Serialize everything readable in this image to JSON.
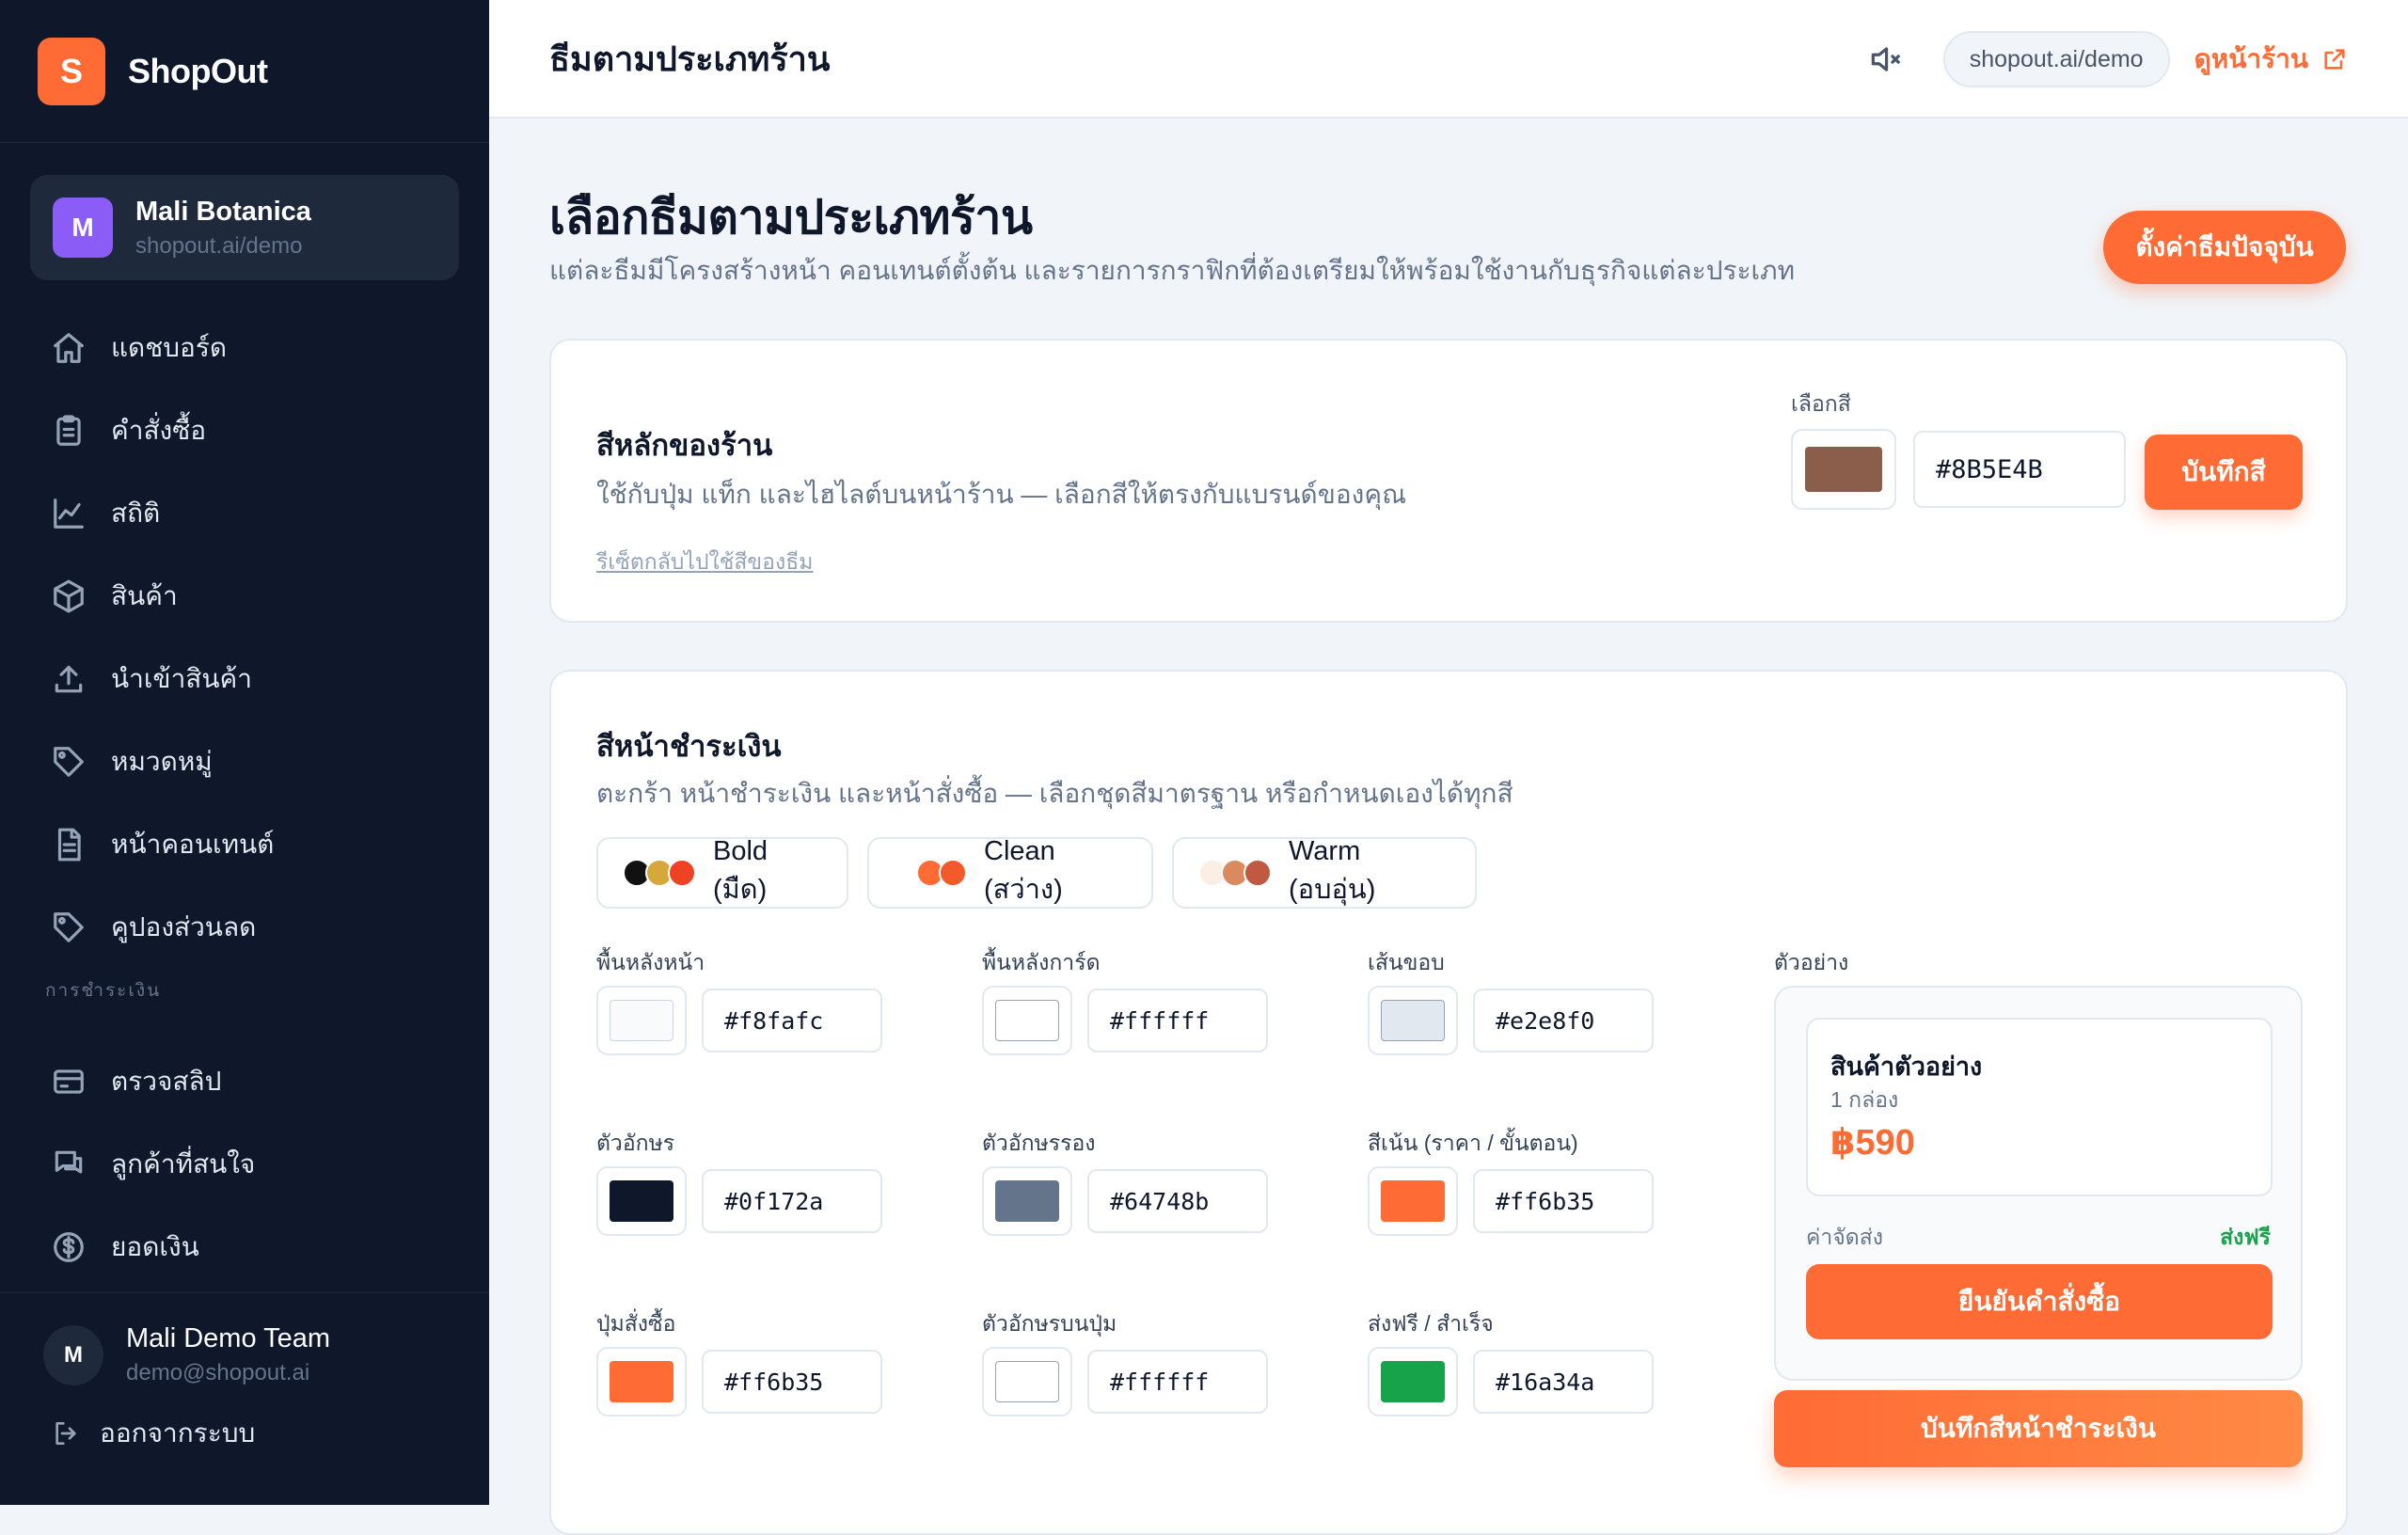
{
  "brand": {
    "logo_letter": "S",
    "name": "ShopOut"
  },
  "store": {
    "avatar_letter": "M",
    "name": "Mali Botanica",
    "url": "shopout.ai/demo"
  },
  "nav": {
    "items": [
      {
        "label": "แดชบอร์ด",
        "icon": "home-icon"
      },
      {
        "label": "คำสั่งซื้อ",
        "icon": "clipboard-icon"
      },
      {
        "label": "สถิติ",
        "icon": "chart-line-icon"
      },
      {
        "label": "สินค้า",
        "icon": "box-icon"
      },
      {
        "label": "นำเข้าสินค้า",
        "icon": "upload-icon"
      },
      {
        "label": "หมวดหมู่",
        "icon": "tag-icon"
      },
      {
        "label": "หน้าคอนเทนต์",
        "icon": "document-icon"
      },
      {
        "label": "คูปองส่วนลด",
        "icon": "ticket-icon"
      }
    ],
    "section_payment": "การชำระเงิน",
    "payment_items": [
      {
        "label": "ตรวจสลิป",
        "icon": "credit-card-icon"
      },
      {
        "label": "ลูกค้าที่สนใจ",
        "icon": "chat-icon"
      },
      {
        "label": "ยอดเงิน",
        "icon": "dollar-icon"
      }
    ]
  },
  "user": {
    "avatar_letter": "M",
    "name": "Mali Demo Team",
    "email": "demo@shopout.ai",
    "logout_label": "ออกจากระบบ"
  },
  "topbar": {
    "title": "ธีมตามประเภทร้าน",
    "url": "shopout.ai/demo",
    "view_store_label": "ดูหน้าร้าน"
  },
  "page": {
    "title": "เลือกธีมตามประเภทร้าน",
    "subtitle": "แต่ละธีมมีโครงสร้างหน้า คอนเทนต์ตั้งต้น และรายการกราฟิกที่ต้องเตรียมให้พร้อมใช้งานกับธุรกิจแต่ละประเภท",
    "theme_settings_button": "ตั้งค่าธีมปัจจุบัน"
  },
  "main_color": {
    "title": "สีหลักของร้าน",
    "description": "ใช้กับปุ่ม แท็ก และไฮไลต์บนหน้าร้าน — เลือกสีให้ตรงกับแบรนด์ของคุณ",
    "reset_link": "รีเซ็ตกลับไปใช้สีของธีม",
    "picker_label": "เลือกสี",
    "value": "#8B5E4B",
    "save_button": "บันทึกสี"
  },
  "checkout_colors": {
    "title": "สีหน้าชำระเงิน",
    "description": "ตะกร้า หน้าชำระเงิน และหน้าสั่งซื้อ — เลือกชุดสีมาตรฐาน หรือกำหนดเองได้ทุกสี",
    "presets": [
      {
        "label": "Bold (มืด)",
        "colors": [
          "#111111",
          "#d4a83a",
          "#ef4123"
        ]
      },
      {
        "label": "Clean (สว่าง)",
        "colors": [
          "#ffffff",
          "#ff6b35",
          "#f25a29"
        ]
      },
      {
        "label": "Warm (อบอุ่น)",
        "colors": [
          "#fbeee4",
          "#d98b5f",
          "#c0593f"
        ]
      }
    ],
    "fields": [
      {
        "label": "พื้นหลังหน้า",
        "value": "#f8fafc"
      },
      {
        "label": "พื้นหลังการ์ด",
        "value": "#ffffff"
      },
      {
        "label": "เส้นขอบ",
        "value": "#e2e8f0"
      },
      {
        "label": "ตัวอักษร",
        "value": "#0f172a"
      },
      {
        "label": "ตัวอักษรรอง",
        "value": "#64748b"
      },
      {
        "label": "สีเน้น (ราคา / ขั้นตอน)",
        "value": "#ff6b35"
      },
      {
        "label": "ปุ่มสั่งซื้อ",
        "value": "#ff6b35"
      },
      {
        "label": "ตัวอักษรบนปุ่ม",
        "value": "#ffffff"
      },
      {
        "label": "ส่งฟรี / สำเร็จ",
        "value": "#16a34a"
      }
    ],
    "preview": {
      "label": "ตัวอย่าง",
      "product_name": "สินค้าตัวอย่าง",
      "product_unit": "1 กล่อง",
      "price": "฿590",
      "shipping_label": "ค่าจัดส่ง",
      "shipping_value": "ส่งฟรี",
      "confirm_button": "ยืนยันคำสั่งซื้อ"
    },
    "save_button": "บันทึกสีหน้าชำระเงิน"
  }
}
